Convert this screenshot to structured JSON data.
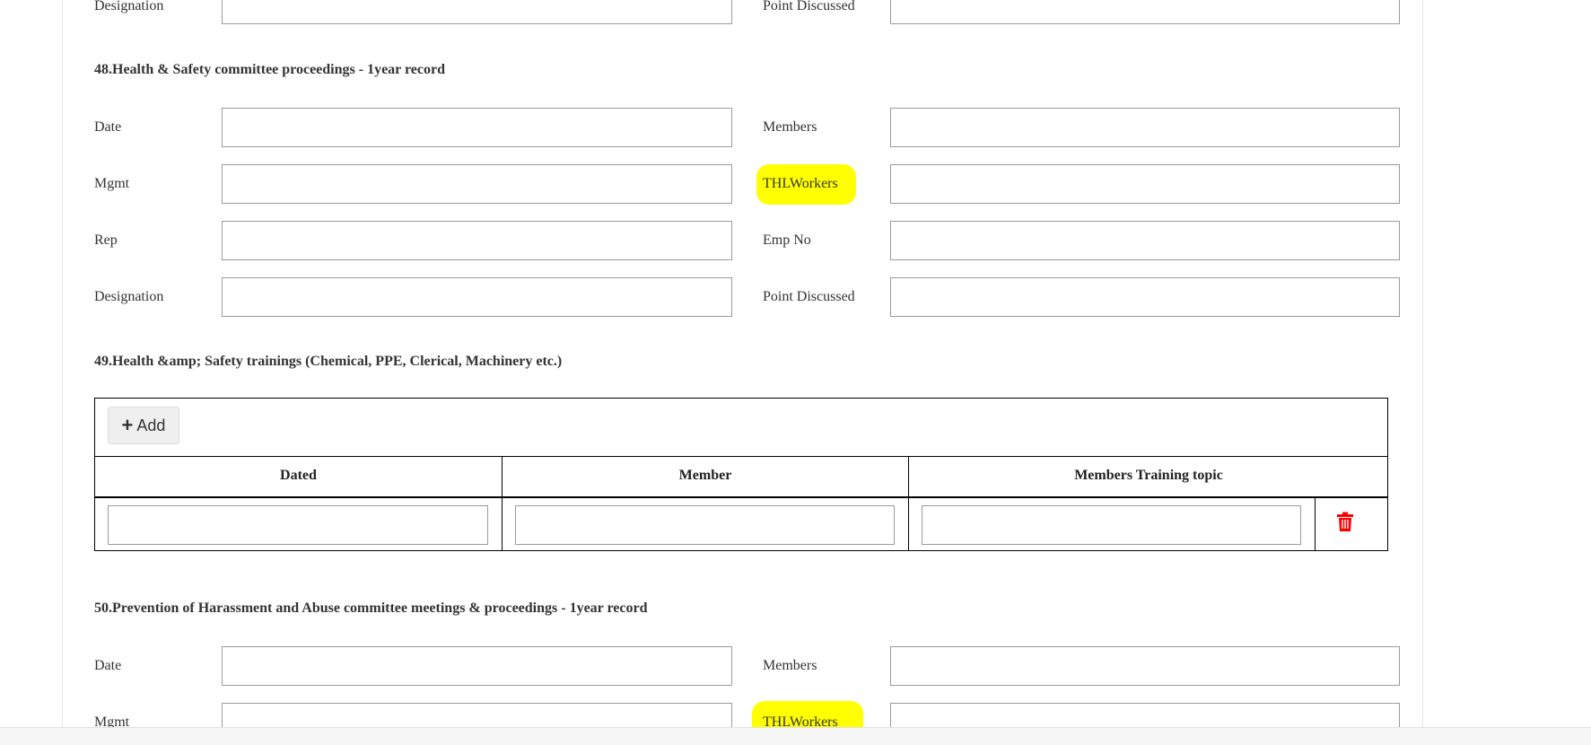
{
  "section_top": {
    "designation_label": "Designation",
    "point_discussed_label": "Point Discussed"
  },
  "section48": {
    "heading": "48.Health & Safety committee proceedings - 1year record",
    "date_label": "Date",
    "members_label": "Members",
    "mgmt_label": "Mgmt",
    "thl_workers_label": "THLWorkers",
    "rep_label": "Rep",
    "emp_no_label": "Emp No",
    "designation_label": "Designation",
    "point_discussed_label": "Point Discussed"
  },
  "section49": {
    "heading": "49.Health &amp; Safety trainings (Chemical, PPE, Clerical, Machinery etc.)",
    "add_label": "Add",
    "columns": [
      "Dated",
      "Member",
      "Members Training topic"
    ],
    "delete_icon": "trash-icon",
    "delete_color": "#ff0000"
  },
  "section50": {
    "heading": "50.Prevention of Harassment and Abuse committee meetings & proceedings - 1year record",
    "date_label": "Date",
    "members_label": "Members",
    "mgmt_label": "Mgmt",
    "thl_workers_label": "THLWorkers"
  },
  "colors": {
    "highlight": "#ffff00",
    "border": "#9a9a9a",
    "table_border": "#000000"
  }
}
